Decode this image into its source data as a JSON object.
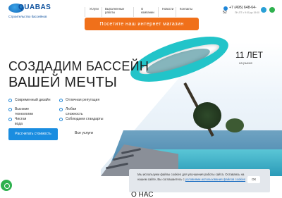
{
  "header": {
    "logo_text": "QUABAS",
    "logo_sub": "Строительство бассейнов",
    "nav": [
      "Услуги",
      "Выполненные работы",
      "О компании",
      "Новости",
      "Контакты"
    ],
    "phone": "+7 (495) 648-64-",
    "phone_end": "52",
    "hours": "ПН-ПТ с 9:00 до 19:00",
    "social": [
      "telegram-icon",
      "whatsapp-icon"
    ]
  },
  "promo": {
    "label": "Посетите наш интернет магазин",
    "color": "#f0701a"
  },
  "hero": {
    "years_value": "11 ЛЕТ",
    "years_sub": "на рынке",
    "title_line1": "СОЗДАДИМ БАССЕЙН",
    "title_line2": "ВАШЕЙ МЕЧТЫ",
    "features": [
      [
        "Современный дизайн"
      ],
      [
        "Отличная репутация"
      ],
      [
        "Высокие",
        "технологии"
      ],
      [
        "Любая",
        "сложность"
      ],
      [
        "Чистая",
        "вода"
      ],
      [
        "Соблюдаем стандарты"
      ]
    ],
    "btn_calc": "Рассчитать стоимость",
    "btn_services": "Все услуги"
  },
  "cookie": {
    "text_before": "Мы используем файлы cookies для улучшения работы сайта. Оставаясь на нашем сайте, Вы соглашаетесь с",
    "link": "условиями использования файлов cookies",
    "ok": "ОК"
  },
  "colors": {
    "accent": "#1a8de0",
    "ring": "#22c4c9",
    "whatsapp": "#2fb14f"
  },
  "bottom_heading": "О НАС"
}
